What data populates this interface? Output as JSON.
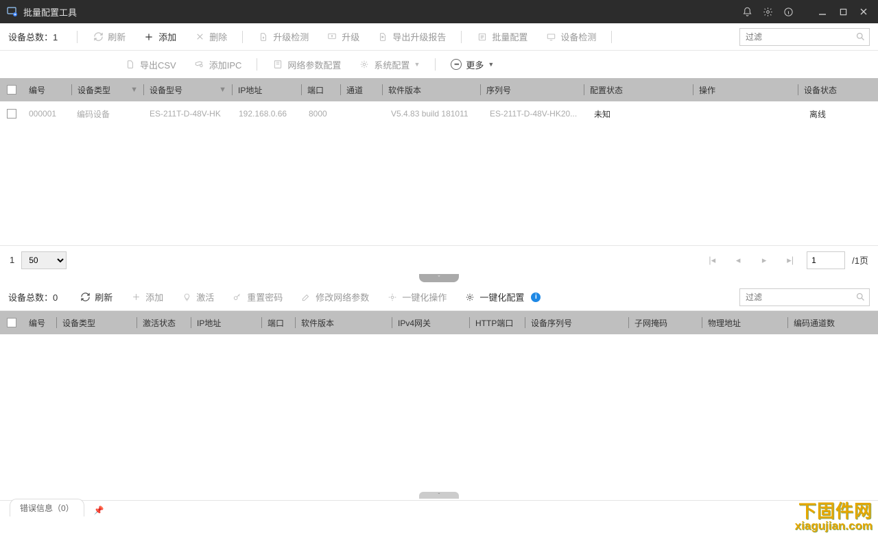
{
  "app": {
    "title": "批量配置工具"
  },
  "top_toolbar": {
    "device_count_label": "设备总数：1",
    "refresh": "刷新",
    "add": "添加",
    "delete": "删除",
    "upgrade_check": "升级检测",
    "upgrade": "升级",
    "export_upgrade_report": "导出升级报告",
    "batch_config": "批量配置",
    "device_check": "设备检测",
    "filter_placeholder": "过滤"
  },
  "top_toolbar2": {
    "export_csv": "导出CSV",
    "add_ipc": "添加IPC",
    "net_param": "网络参数配置",
    "sys_config": "系统配置",
    "more": "更多"
  },
  "table1": {
    "headers": {
      "no": "编号",
      "type": "设备类型",
      "model": "设备型号",
      "ip": "IP地址",
      "port": "端口",
      "channel": "通道",
      "sw": "软件版本",
      "serial": "序列号",
      "cfg": "配置状态",
      "op": "操作",
      "devstat": "设备状态"
    },
    "rows": [
      {
        "no": "000001",
        "type": "编码设备",
        "model": "ES-211T-D-48V-HK",
        "ip": "192.168.0.66",
        "port": "8000",
        "channel": "",
        "sw": "V5.4.83 build 181011",
        "serial": "ES-211T-D-48V-HK20...",
        "cfg": "未知",
        "op": "",
        "devstat": "离线"
      }
    ]
  },
  "pagination": {
    "page_label": "1",
    "page_size": "50",
    "page_input": "1",
    "total": "/1页"
  },
  "bottom_toolbar": {
    "device_count_label": "设备总数：0",
    "refresh": "刷新",
    "add": "添加",
    "activate": "激活",
    "reset_pwd": "重置密码",
    "edit_net": "修改网络参数",
    "one_click_op": "一键化操作",
    "one_click_cfg": "一键化配置",
    "filter_placeholder": "过滤"
  },
  "table2": {
    "headers": {
      "no": "编号",
      "type": "设备类型",
      "act": "激活状态",
      "ip": "IP地址",
      "port": "端口",
      "sw": "软件版本",
      "gw": "IPv4网关",
      "http": "HTTP端口",
      "serial": "设备序列号",
      "mask": "子网掩码",
      "mac": "物理地址",
      "enc": "编码通道数"
    }
  },
  "status": {
    "error_info": "错误信息（0）"
  },
  "watermark": {
    "l1": "下固件网",
    "l2": "xiagujian.com"
  }
}
